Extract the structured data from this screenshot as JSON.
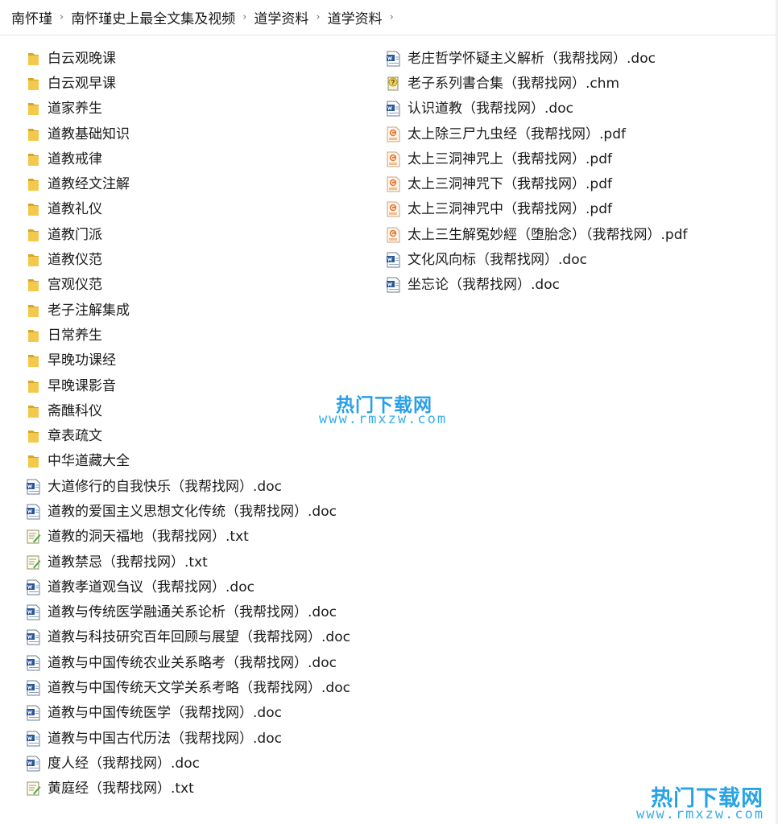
{
  "breadcrumb": [
    "南怀瑾",
    "南怀瑾史上最全文集及视频",
    "道学资料",
    "道学资料"
  ],
  "breadcrumb_separator": "›",
  "left_items": [
    {
      "type": "folder",
      "name": "白云观晚课"
    },
    {
      "type": "folder",
      "name": "白云观早课"
    },
    {
      "type": "folder",
      "name": "道家养生"
    },
    {
      "type": "folder",
      "name": "道教基础知识"
    },
    {
      "type": "folder",
      "name": "道教戒律"
    },
    {
      "type": "folder",
      "name": "道教经文注解"
    },
    {
      "type": "folder",
      "name": "道教礼仪"
    },
    {
      "type": "folder",
      "name": "道教门派"
    },
    {
      "type": "folder",
      "name": "道教仪范"
    },
    {
      "type": "folder",
      "name": "宫观仪范"
    },
    {
      "type": "folder",
      "name": "老子注解集成"
    },
    {
      "type": "folder",
      "name": "日常养生"
    },
    {
      "type": "folder",
      "name": "早晚功课经"
    },
    {
      "type": "folder",
      "name": "早晚课影音"
    },
    {
      "type": "folder",
      "name": "斋醮科仪"
    },
    {
      "type": "folder",
      "name": "章表疏文"
    },
    {
      "type": "folder",
      "name": "中华道藏大全"
    },
    {
      "type": "doc",
      "name": "大道修行的自我快乐（我帮找网）.doc"
    },
    {
      "type": "doc",
      "name": "道教的爱国主义思想文化传统（我帮找网）.doc"
    },
    {
      "type": "txt",
      "name": "道教的洞天福地（我帮找网）.txt"
    },
    {
      "type": "txt",
      "name": "道教禁忌（我帮找网）.txt"
    },
    {
      "type": "doc",
      "name": "道教孝道观刍议（我帮找网）.doc"
    },
    {
      "type": "doc",
      "name": "道教与传统医学融通关系论析（我帮找网）.doc"
    },
    {
      "type": "doc",
      "name": "道教与科技研究百年回顾与展望（我帮找网）.doc"
    },
    {
      "type": "doc",
      "name": "道教与中国传统农业关系略考（我帮找网）.doc"
    },
    {
      "type": "doc",
      "name": "道教与中国传统天文学关系考略（我帮找网）.doc"
    },
    {
      "type": "doc",
      "name": "道教与中国传统医学（我帮找网）.doc"
    },
    {
      "type": "doc",
      "name": "道教与中国古代历法（我帮找网）.doc"
    },
    {
      "type": "doc",
      "name": "度人经（我帮找网）.doc"
    },
    {
      "type": "txt",
      "name": "黄庭经（我帮找网）.txt"
    }
  ],
  "right_items": [
    {
      "type": "doc",
      "name": "老庄哲学怀疑主义解析（我帮找网）.doc"
    },
    {
      "type": "chm",
      "name": "老子系列書合集（我帮找网）.chm"
    },
    {
      "type": "doc",
      "name": "认识道教（我帮找网）.doc"
    },
    {
      "type": "pdf",
      "name": "太上除三尸九虫经（我帮找网）.pdf"
    },
    {
      "type": "pdf",
      "name": "太上三洞神咒上（我帮找网）.pdf"
    },
    {
      "type": "pdf",
      "name": "太上三洞神咒下（我帮找网）.pdf"
    },
    {
      "type": "pdf",
      "name": "太上三洞神咒中（我帮找网）.pdf"
    },
    {
      "type": "pdf",
      "name": "太上三生解冤妙經（堕胎念）（我帮找网）.pdf"
    },
    {
      "type": "doc",
      "name": "文化风向标（我帮找网）.doc"
    },
    {
      "type": "doc",
      "name": "坐忘论（我帮找网）.doc"
    }
  ],
  "watermark": {
    "title": "热门下载网",
    "url": "www.rmxzw.com"
  },
  "colors": {
    "folder": "#f2c94c",
    "folder_dark": "#d9a520",
    "doc_blue": "#2b5797",
    "pdf_orange": "#e8772e",
    "txt_green": "#4caf50",
    "watermark": "#2aa0e8"
  }
}
